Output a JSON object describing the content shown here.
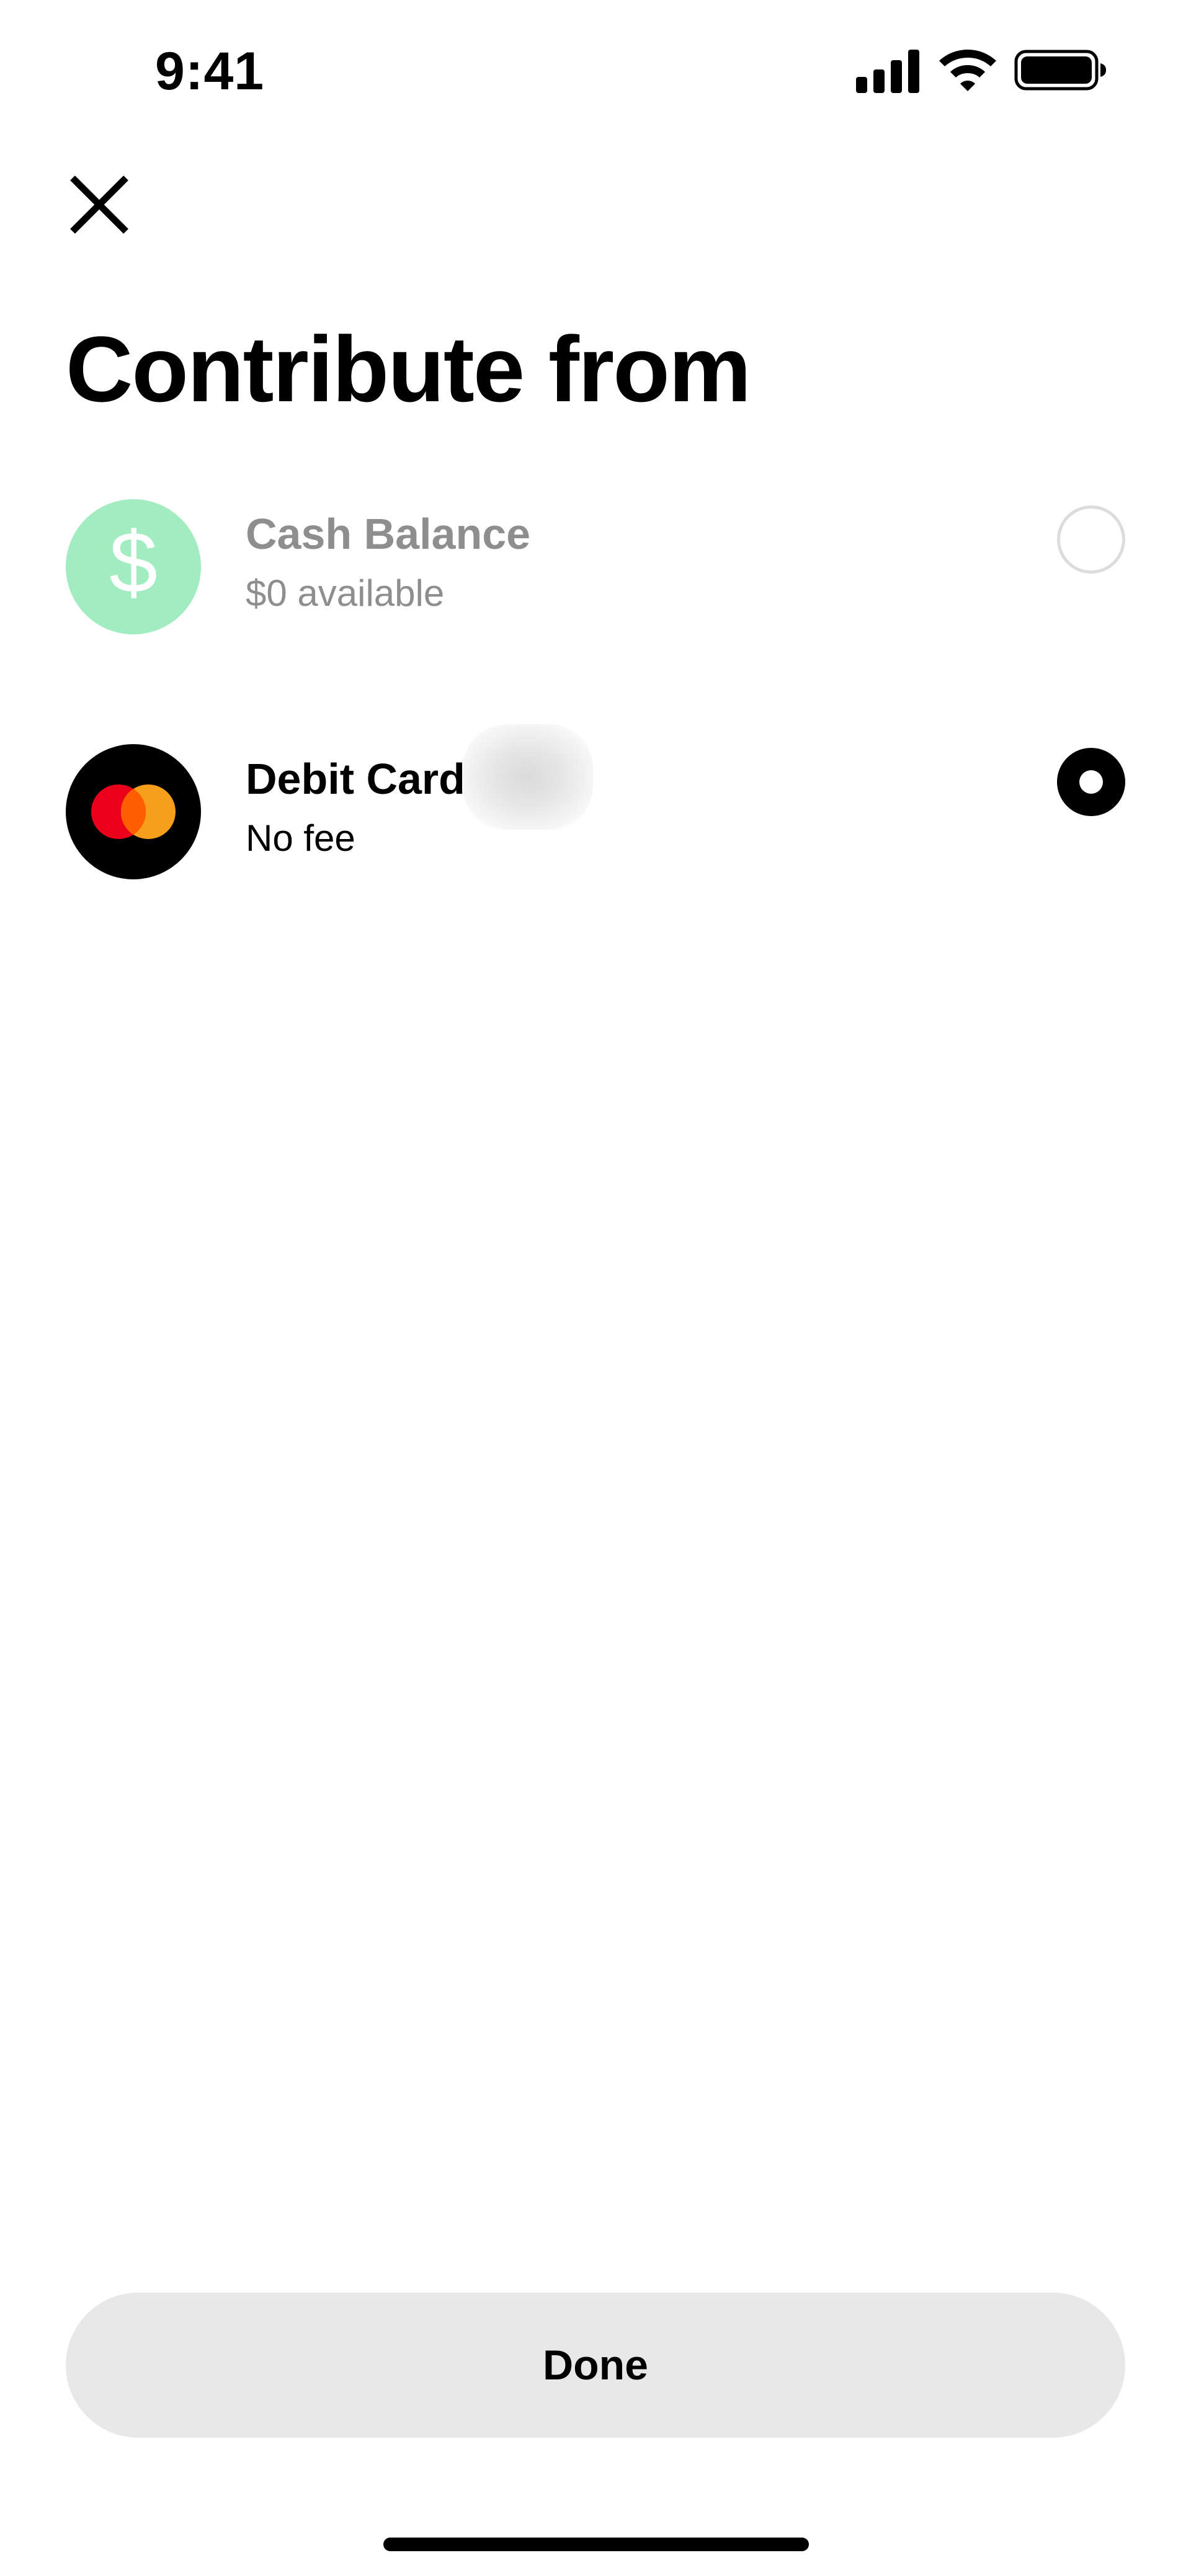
{
  "status_bar": {
    "time": "9:41",
    "icons": [
      "cellular-signal-icon",
      "wifi-icon",
      "battery-icon"
    ]
  },
  "header": {
    "close_icon": "close-icon",
    "title": "Contribute from"
  },
  "options": [
    {
      "title": "Cash Balance",
      "subtitle": "$0 available",
      "icon": "dollar-sign-icon",
      "icon_bg": "#a1ecc0",
      "selected": false,
      "disabled": true
    },
    {
      "title": "Debit Card",
      "subtitle": "No fee",
      "icon": "mastercard-icon",
      "icon_bg": "#000000",
      "selected": true,
      "disabled": false
    }
  ],
  "footer": {
    "done_label": "Done"
  },
  "colors": {
    "cash_green": "#a1ecc0",
    "disabled_text": "#8e8e8e",
    "button_bg": "#e8e8e8",
    "mastercard_red": "#eb001b",
    "mastercard_orange": "#f79e1b"
  }
}
